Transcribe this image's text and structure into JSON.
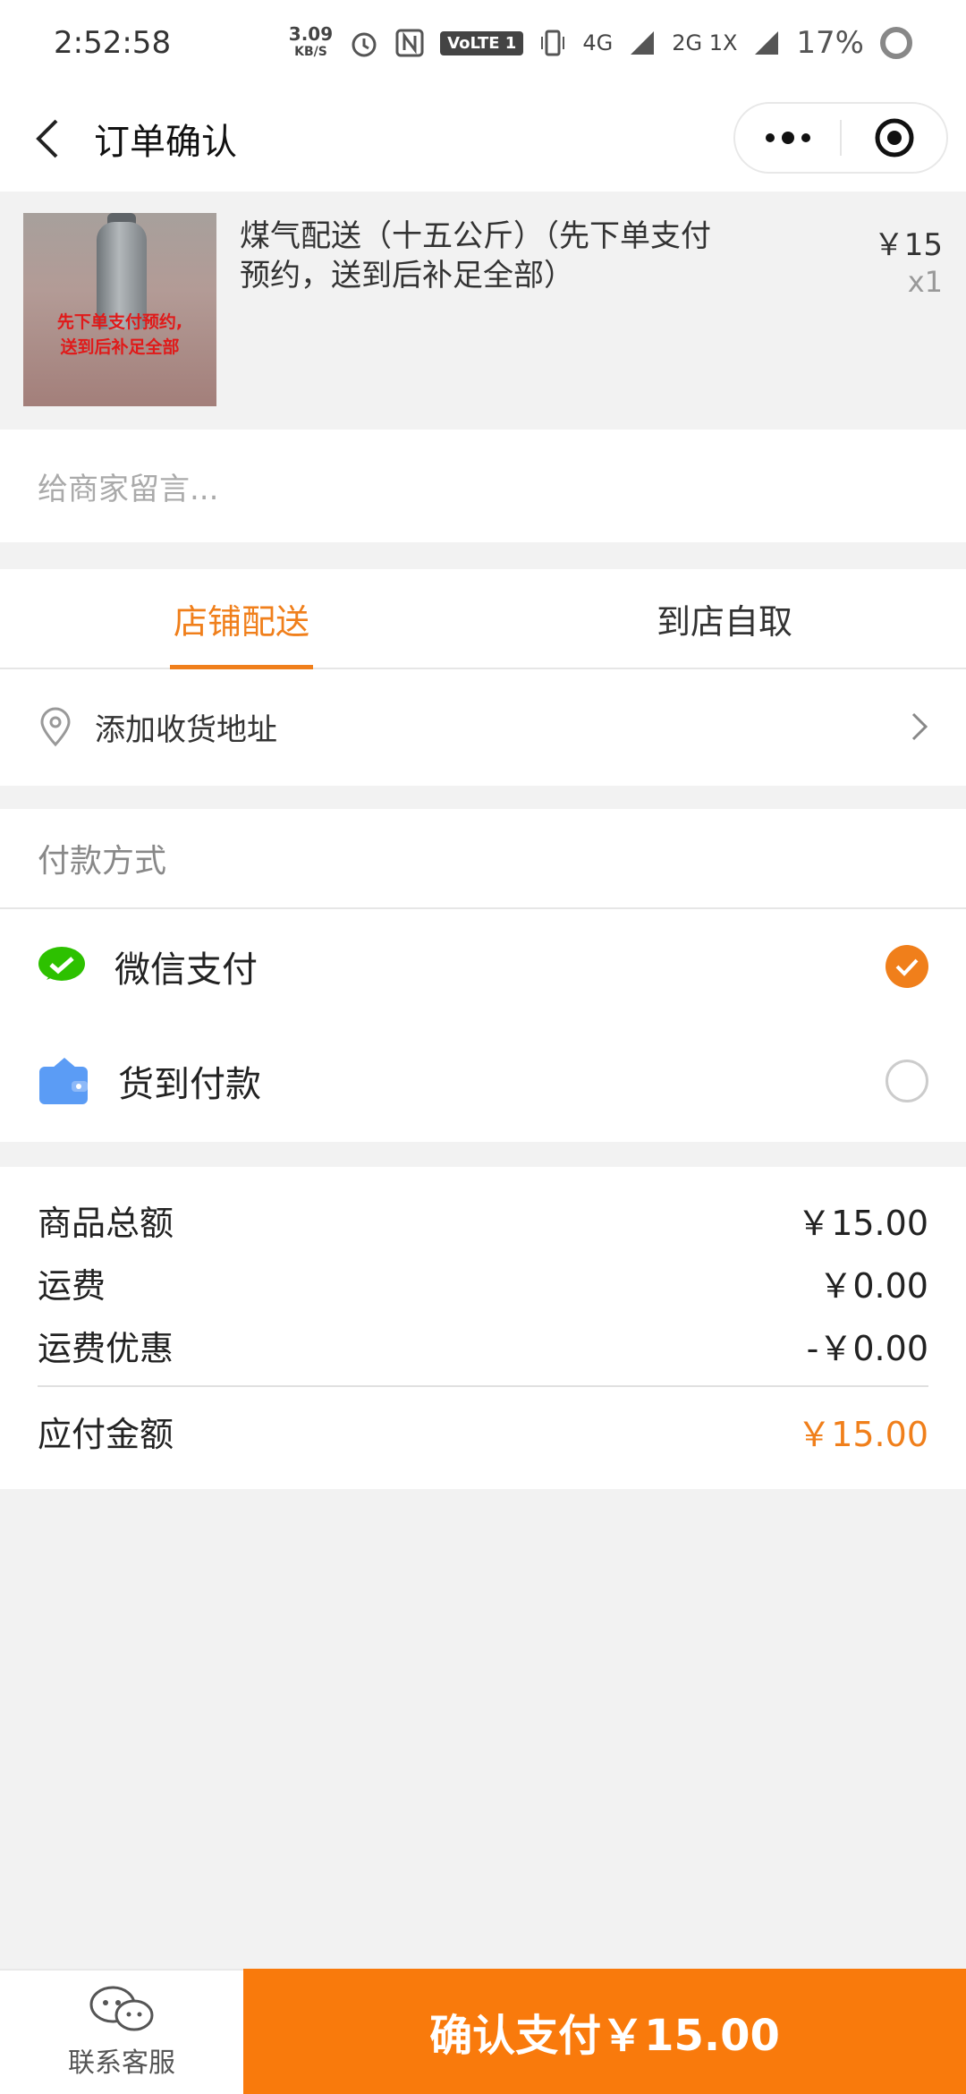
{
  "status_bar": {
    "time": "2:52:58",
    "net_speed_value": "3.09",
    "net_speed_unit": "KB/S",
    "volte": "VoLTE 1",
    "sig1": "4G",
    "sig2": "2G 1X",
    "battery": "17%"
  },
  "nav": {
    "title": "订单确认"
  },
  "product": {
    "image_text_line1": "先下单支付预约,",
    "image_text_line2": "送到后补足全部",
    "name": "煤气配送（十五公斤）（先下单支付预约，送到后补足全部）",
    "price": "￥15",
    "qty": "x1"
  },
  "message": {
    "placeholder": "给商家留言..."
  },
  "delivery": {
    "tabs": [
      {
        "label": "店铺配送",
        "active": true
      },
      {
        "label": "到店自取",
        "active": false
      }
    ],
    "address_label": "添加收货地址"
  },
  "payment": {
    "heading": "付款方式",
    "options": [
      {
        "label": "微信支付",
        "icon": "wechat-pay-icon",
        "selected": true
      },
      {
        "label": "货到付款",
        "icon": "wallet-icon",
        "selected": false
      }
    ]
  },
  "summary": {
    "rows": [
      {
        "label": "商品总额",
        "value": "￥15.00"
      },
      {
        "label": "运费",
        "value": "￥0.00"
      },
      {
        "label": "运费优惠",
        "value": "-￥0.00"
      }
    ],
    "total_label": "应付金额",
    "total_value": "￥15.00"
  },
  "bottom": {
    "service_label": "联系客服",
    "pay_button": "确认支付￥15.00"
  },
  "colors": {
    "accent": "#f07f1b",
    "pay_button": "#f97a0c",
    "wechat_green": "#2dc100",
    "wallet_blue": "#5b9cf5"
  }
}
